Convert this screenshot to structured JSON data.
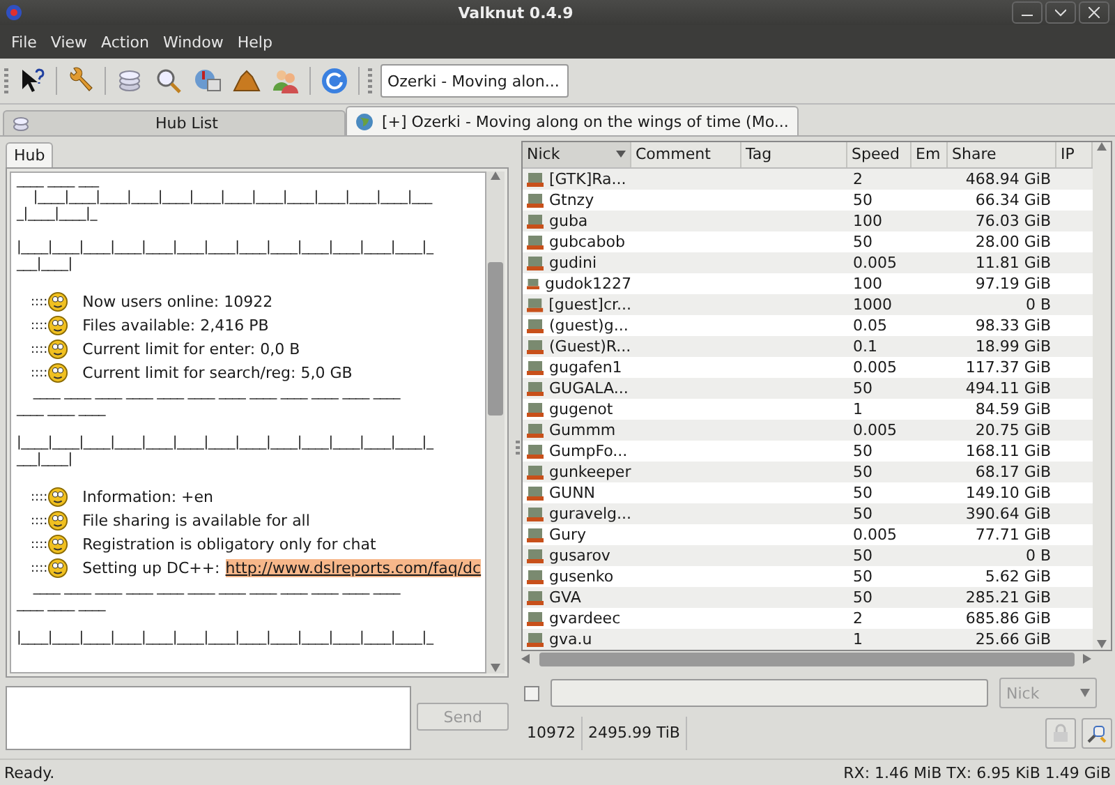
{
  "window": {
    "title": "Valknut 0.4.9"
  },
  "menu": [
    "File",
    "View",
    "Action",
    "Window",
    "Help"
  ],
  "toolbar": {
    "hub_combo": {
      "value": "Ozerki - Moving alon..."
    }
  },
  "tabs": [
    {
      "label": "Hub List",
      "selected": false
    },
    {
      "label": "[+] Ozerki - Moving along on the wings of time (Mo...",
      "selected": true
    }
  ],
  "hub_tabs": [
    {
      "label": "Hub",
      "selected": true
    }
  ],
  "chat": [
    {
      "kind": "art",
      "text": "____ ____ ___"
    },
    {
      "kind": "art",
      "text": "    |____|____|____|____|____|____|____|____|____|____|____|____|___"
    },
    {
      "kind": "art",
      "text": "_|____|____|_"
    },
    {
      "kind": "gap"
    },
    {
      "kind": "art",
      "text": "|____|____|____|____|____|____|____|____|____|____|____|____|____|_"
    },
    {
      "kind": "art",
      "text": "___|____|"
    },
    {
      "kind": "gap"
    },
    {
      "kind": "message",
      "prefix": "::::",
      "text": "Now users online: 10922"
    },
    {
      "kind": "message",
      "prefix": "::::",
      "text": "Files available: 2,416 PB"
    },
    {
      "kind": "message",
      "prefix": "::::",
      "text": "Current limit for enter: 0,0 B"
    },
    {
      "kind": "message",
      "prefix": "::::",
      "text": "Current limit for search/reg: 5,0 GB"
    },
    {
      "kind": "art",
      "text": "    ____ ____ ____ ____ ____ ____ ____ ____ ____ ____ ____ ____"
    },
    {
      "kind": "art",
      "text": "____ ____ ____"
    },
    {
      "kind": "gap"
    },
    {
      "kind": "art",
      "text": "|____|____|____|____|____|____|____|____|____|____|____|____|____|_"
    },
    {
      "kind": "art",
      "text": "___|____|"
    },
    {
      "kind": "gap"
    },
    {
      "kind": "message",
      "prefix": "::::",
      "text": "Information: +en"
    },
    {
      "kind": "message",
      "prefix": "::::",
      "text": "File sharing is available for all"
    },
    {
      "kind": "message",
      "prefix": "::::",
      "text": "Registration is obligatory only for chat"
    },
    {
      "kind": "message",
      "prefix": "::::",
      "text": "Setting up DC++:",
      "link": "http://www.dslreports.com/faq/dc"
    },
    {
      "kind": "art",
      "text": "    ____ ____ ____ ____ ____ ____ ____ ____ ____ ____ ____ ____"
    },
    {
      "kind": "art",
      "text": "____ ____ ____"
    },
    {
      "kind": "gap"
    },
    {
      "kind": "art",
      "text": "|____|____|____|____|____|____|____|____|____|____|____|____|____|_"
    }
  ],
  "send_button": {
    "label": "Send",
    "disabled": true
  },
  "users_table": {
    "columns": [
      {
        "label": "Nick",
        "sorted": true
      },
      {
        "label": "Comment",
        "sorted": false
      },
      {
        "label": "Tag",
        "sorted": false
      },
      {
        "label": "Speed",
        "sorted": false
      },
      {
        "label": "Em",
        "sorted": false
      },
      {
        "label": "Share",
        "sorted": false
      },
      {
        "label": "IP",
        "sorted": false
      }
    ],
    "rows": [
      {
        "nick": "[GTK]Ra...",
        "speed": "2",
        "share": "468.94 GiB"
      },
      {
        "nick": "Gtnzy",
        "speed": "50",
        "share": "66.34 GiB"
      },
      {
        "nick": "guba",
        "speed": "100",
        "share": "76.03 GiB"
      },
      {
        "nick": "gubcabob",
        "speed": "50",
        "share": "28.00 GiB"
      },
      {
        "nick": "gudini",
        "speed": "0.005",
        "share": "11.81 GiB"
      },
      {
        "nick": "gudok1227",
        "speed": "100",
        "share": "97.19 GiB"
      },
      {
        "nick": "[guest]cr...",
        "speed": "1000",
        "share": "0 B"
      },
      {
        "nick": "(guest)g...",
        "speed": "0.05",
        "share": "98.33 GiB"
      },
      {
        "nick": "(Guest)R...",
        "speed": "0.1",
        "share": "18.99 GiB"
      },
      {
        "nick": "gugafen1",
        "speed": "0.005",
        "share": "117.37 GiB"
      },
      {
        "nick": "GUGALA...",
        "speed": "50",
        "share": "494.11 GiB"
      },
      {
        "nick": "gugenot",
        "speed": "1",
        "share": "84.59 GiB"
      },
      {
        "nick": "Gummm",
        "speed": "0.005",
        "share": "20.75 GiB"
      },
      {
        "nick": "GumpFo...",
        "speed": "50",
        "share": "168.11 GiB"
      },
      {
        "nick": "gunkeeper",
        "speed": "50",
        "share": "68.17 GiB"
      },
      {
        "nick": "GUNN",
        "speed": "50",
        "share": "149.10 GiB"
      },
      {
        "nick": "guravelg...",
        "speed": "50",
        "share": "390.64 GiB"
      },
      {
        "nick": "Gury",
        "speed": "0.005",
        "share": "77.71 GiB"
      },
      {
        "nick": "gusarov",
        "speed": "50",
        "share": "0 B"
      },
      {
        "nick": "gusenko",
        "speed": "50",
        "share": "5.62 GiB"
      },
      {
        "nick": "GVA",
        "speed": "50",
        "share": "285.21 GiB"
      },
      {
        "nick": "gvardeec",
        "speed": "2",
        "share": "685.86 GiB"
      },
      {
        "nick": "gva.u",
        "speed": "1",
        "share": "25.66 GiB"
      }
    ]
  },
  "filter": {
    "checked": false,
    "field_combo": {
      "value": "Nick",
      "disabled": true
    }
  },
  "stats": {
    "users": "10972",
    "share": "2495.99 TiB"
  },
  "status_bar": {
    "message": "Ready.",
    "traffic": "RX: 1.46 MiB TX: 6.95 KiB 1.49 GiB"
  }
}
